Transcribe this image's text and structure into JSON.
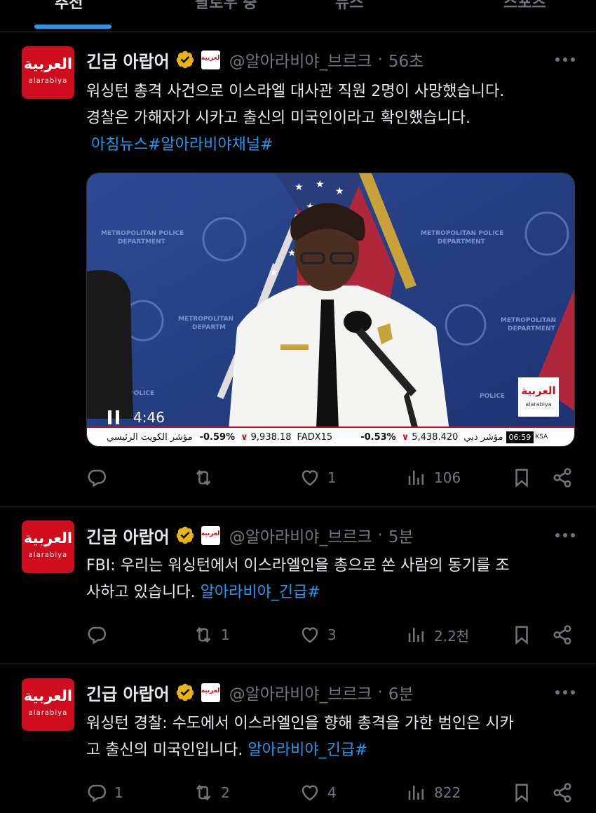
{
  "tabs": [
    "추천",
    "팔로우 중",
    "뉴스",
    "스포츠"
  ],
  "tweets": [
    {
      "name": "긴급 아랍어",
      "handle": "@알아라비야_브르크",
      "time": "56초",
      "text_lines": [
        "워싱턴 총격 사건으로 이스라엘 대사관 직원 2명이 사망했습니다.",
        "경찰은 가해자가 시카고 출신의 미국인이라고 확인했습니다."
      ],
      "link": " 아침뉴스#알아라비야채널#",
      "video": {
        "duration": "4:46",
        "ticker": {
          "label1": "مؤشر الكويت الرئيسي",
          "pct1": "-0.59%",
          "val1": "9,938.18",
          "sym1": "FADX15",
          "pct2": "-0.53%",
          "val2": "5,438.420",
          "label2": "مؤشر دبي",
          "clock": "06:59",
          "clock_suffix": "KSA"
        },
        "watermark_ar": "العربية",
        "watermark_lat": "alarabiya",
        "backdrop": "METROPOLITAN POLICE DEPARTMENT"
      },
      "counts": {
        "reply": "",
        "retweet": "",
        "like": "1",
        "views": "106"
      }
    },
    {
      "name": "긴급 아랍어",
      "handle": "@알아라비야_브르크",
      "time": "5분",
      "text_lines": [
        "FBI: 우리는 워싱턴에서 이스라엘인을 총으로 쏜 사람의 동기를 조",
        "사하고 있습니다. "
      ],
      "link": "알아라비야_긴급#",
      "counts": {
        "reply": "",
        "retweet": "1",
        "like": "3",
        "views": "2.2천"
      }
    },
    {
      "name": "긴급 아랍어",
      "handle": "@알아라비야_브르크",
      "time": "6분",
      "text_lines": [
        "워싱턴 경찰: 수도에서 이스라엘인을 향해 총격을 가한 범인은 시카",
        "고 출신의 미국인입니다. "
      ],
      "link": "알아라비야_긴급#",
      "counts": {
        "reply": "1",
        "retweet": "2",
        "like": "4",
        "views": "822"
      }
    }
  ],
  "avatar": {
    "ar": "العربية",
    "lat": "alarabiya"
  },
  "org_badge": "العربية",
  "colors": {
    "accent": "#1d9bf0",
    "brand": "#d00d1e",
    "muted": "#71767b",
    "verified": "#e8b40e"
  }
}
